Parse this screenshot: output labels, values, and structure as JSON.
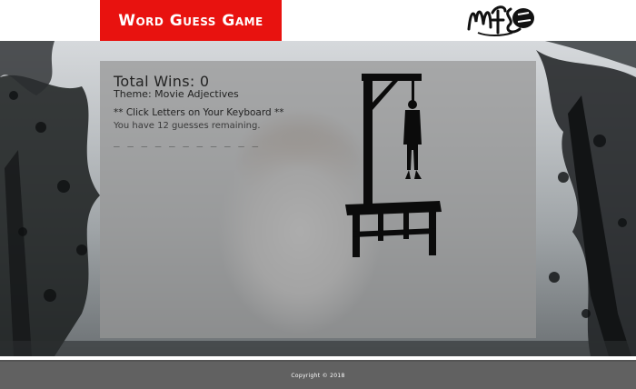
{
  "header": {
    "title": "Word Guess Game",
    "logo_icon": "mfs-logo-icon"
  },
  "game": {
    "wins_label": "Total Wins: 0",
    "theme_label": "Theme: Movie Adjectives",
    "instruction": "** Click Letters on Your Keyboard **",
    "guesses_remaining": "You have 12 guesses remaining.",
    "word_blanks": "_ _ _ _ _ _ _ _ _ _ _",
    "image_icon": "hangman-gallows-icon"
  },
  "footer": {
    "copyright": "Copyright © 2018"
  },
  "colors": {
    "title_bg": "#e8120f",
    "footer_bg": "#616161",
    "panel_overlay": "rgba(150,150,150,0.72)"
  }
}
